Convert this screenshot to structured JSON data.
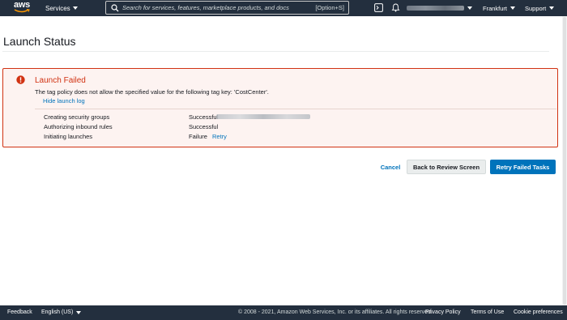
{
  "topnav": {
    "logo_text": "aws",
    "services_label": "Services",
    "search_placeholder": "Search for services, features, marketplace products, and docs",
    "search_hint": "[Option+S]",
    "region_label": "Frankfurt",
    "support_label": "Support"
  },
  "page": {
    "title": "Launch Status"
  },
  "alert": {
    "title": "Launch Failed",
    "message": "The tag policy does not allow the specified value for the following tag key: 'CostCenter'.",
    "toggle_log_label": "Hide launch log",
    "log": [
      {
        "step": "Creating security groups",
        "status": "Successful"
      },
      {
        "step": "Authorizing inbound rules",
        "status": "Successful"
      },
      {
        "step": "Initiating launches",
        "status": "Failure",
        "action": "Retry"
      }
    ]
  },
  "actions": {
    "cancel_label": "Cancel",
    "review_label": "Back to Review Screen",
    "retry_label": "Retry Failed Tasks"
  },
  "footer": {
    "feedback_label": "Feedback",
    "language_label": "English (US)",
    "copyright": "© 2008 - 2021, Amazon Web Services, Inc. or its affiliates. All rights reserved.",
    "privacy_label": "Privacy Policy",
    "terms_label": "Terms of Use",
    "cookies_label": "Cookie preferences"
  },
  "colors": {
    "nav_bg": "#232f3e",
    "error": "#d13212",
    "link": "#0073bb",
    "primary_button": "#0073bb"
  },
  "icons": [
    "aws-logo",
    "caret-down-icon",
    "search-icon",
    "cloudshell-icon",
    "bell-icon",
    "error-icon"
  ]
}
